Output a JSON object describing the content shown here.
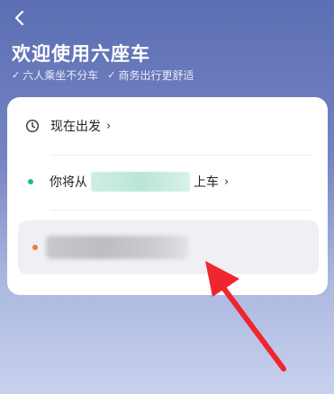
{
  "header": {
    "title": "欢迎使用六座车",
    "taglines": [
      {
        "check": "✓",
        "text": "六人乘坐不分车"
      },
      {
        "check": "✓",
        "text": "商务出行更舒适"
      }
    ]
  },
  "card": {
    "depart_label": "现在出发",
    "pickup_prefix": "你将从",
    "pickup_suffix": "上车",
    "chevron": "›"
  },
  "colors": {
    "pickup_dot": "#1bbf8e",
    "dest_dot": "#f07a3e",
    "annotation_arrow": "#f0262f"
  }
}
